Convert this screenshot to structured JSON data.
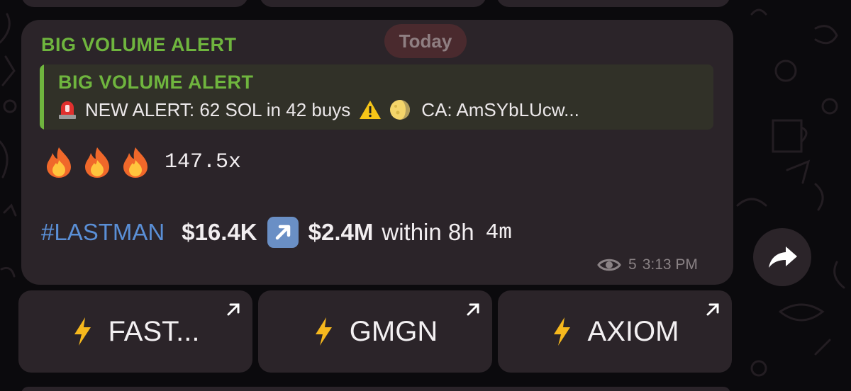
{
  "date_pill": "Today",
  "message": {
    "sender": "BIG VOLUME ALERT",
    "reply": {
      "title": "BIG VOLUME ALERT",
      "text_prefix": "NEW ALERT: 62 SOL in 42 buys",
      "text_suffix": "CA: AmSYbLUcw..."
    },
    "multiplier": "147.5x",
    "hashtag": "#LASTMAN",
    "mcap_from": "$16.4K",
    "mcap_to": "$2.4M",
    "within_label": "within 8h",
    "minutes": "4m",
    "views": "5",
    "time": "3:13 PM"
  },
  "buttons": [
    {
      "label": "FAST..."
    },
    {
      "label": "GMGN"
    },
    {
      "label": "AXIOM"
    }
  ],
  "colors": {
    "accent_green": "#6fb53e",
    "hashtag_blue": "#5a8fd6",
    "bubble": "#2b2429",
    "background": "#0b0a0d"
  },
  "icons": [
    "rotating-light-icon",
    "warning-icon",
    "moon-icon",
    "fire-icon",
    "up-right-arrow-icon",
    "eye-icon",
    "share-icon",
    "lightning-icon",
    "open-link-arrow-icon"
  ]
}
